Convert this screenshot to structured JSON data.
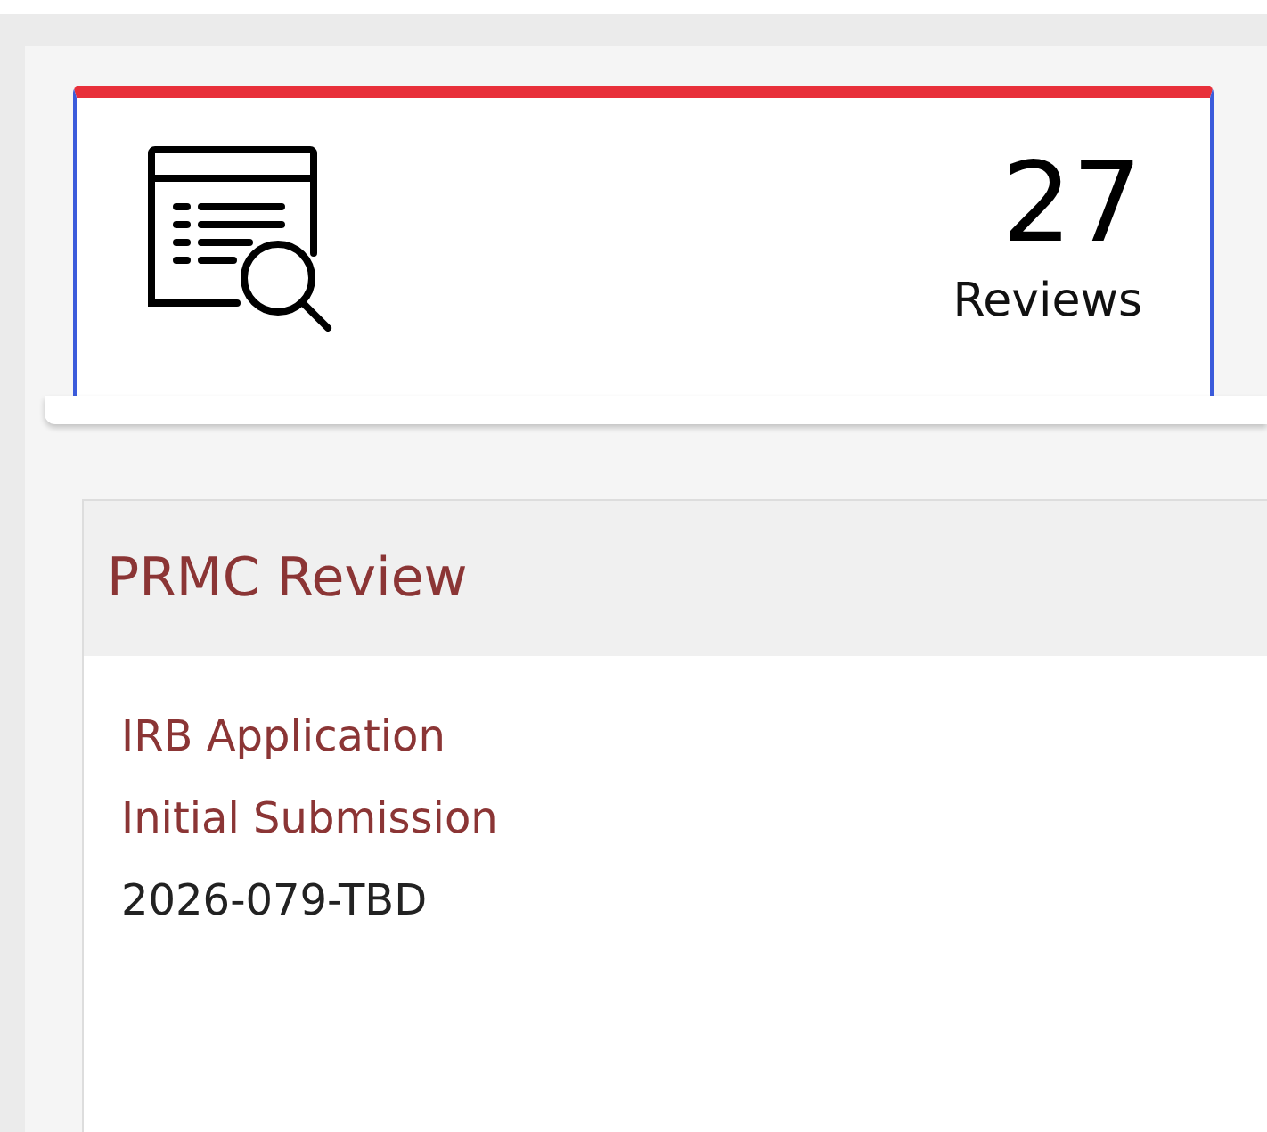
{
  "stat_card": {
    "count": "27",
    "label": "Reviews"
  },
  "review_panel": {
    "title": "PRMC Review",
    "lines": [
      {
        "kind": "link",
        "text": "IRB Application"
      },
      {
        "kind": "link",
        "text": "Initial Submission"
      },
      {
        "kind": "plain",
        "text": "2026-079-TBD"
      }
    ]
  }
}
